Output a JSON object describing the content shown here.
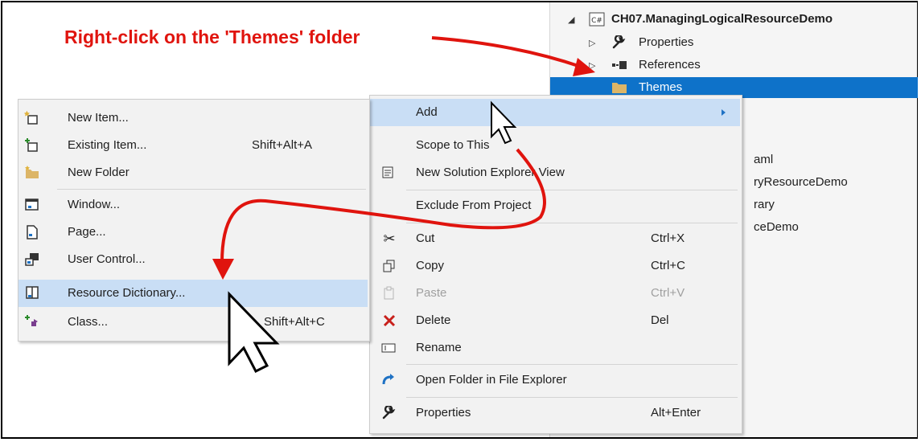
{
  "annotation": {
    "text": "Right-click on the 'Themes' folder"
  },
  "solution_explorer": {
    "project": {
      "badge": "C#",
      "name": "CH07.ManagingLogicalResourceDemo"
    },
    "items": [
      {
        "label": "Properties"
      },
      {
        "label": "References"
      },
      {
        "label": "Themes"
      }
    ],
    "partial_lines": [
      "aml",
      "ryResourceDemo",
      "rary",
      "ceDemo"
    ]
  },
  "context_menu": {
    "items": [
      {
        "label": "Add",
        "shortcut": ""
      },
      {
        "label": "Scope to This",
        "shortcut": ""
      },
      {
        "label": "New Solution Explorer View",
        "shortcut": ""
      },
      {
        "label": "Exclude From Project",
        "shortcut": ""
      },
      {
        "label": "Cut",
        "shortcut": "Ctrl+X"
      },
      {
        "label": "Copy",
        "shortcut": "Ctrl+C"
      },
      {
        "label": "Paste",
        "shortcut": "Ctrl+V"
      },
      {
        "label": "Delete",
        "shortcut": "Del"
      },
      {
        "label": "Rename",
        "shortcut": ""
      },
      {
        "label": "Open Folder in File Explorer",
        "shortcut": ""
      },
      {
        "label": "Properties",
        "shortcut": "Alt+Enter"
      }
    ]
  },
  "add_submenu": {
    "items": [
      {
        "label": "New Item...",
        "shortcut": ""
      },
      {
        "label": "Existing Item...",
        "shortcut": "Shift+Alt+A"
      },
      {
        "label": "New Folder",
        "shortcut": ""
      },
      {
        "label": "Window...",
        "shortcut": ""
      },
      {
        "label": "Page...",
        "shortcut": ""
      },
      {
        "label": "User Control...",
        "shortcut": ""
      },
      {
        "label": "Resource Dictionary...",
        "shortcut": ""
      },
      {
        "label": "Class...",
        "shortcut": "Shift+Alt+C"
      }
    ]
  },
  "colors": {
    "annotation": "#e0140e",
    "selection": "#0e72c9",
    "highlight": "#c9def5"
  }
}
